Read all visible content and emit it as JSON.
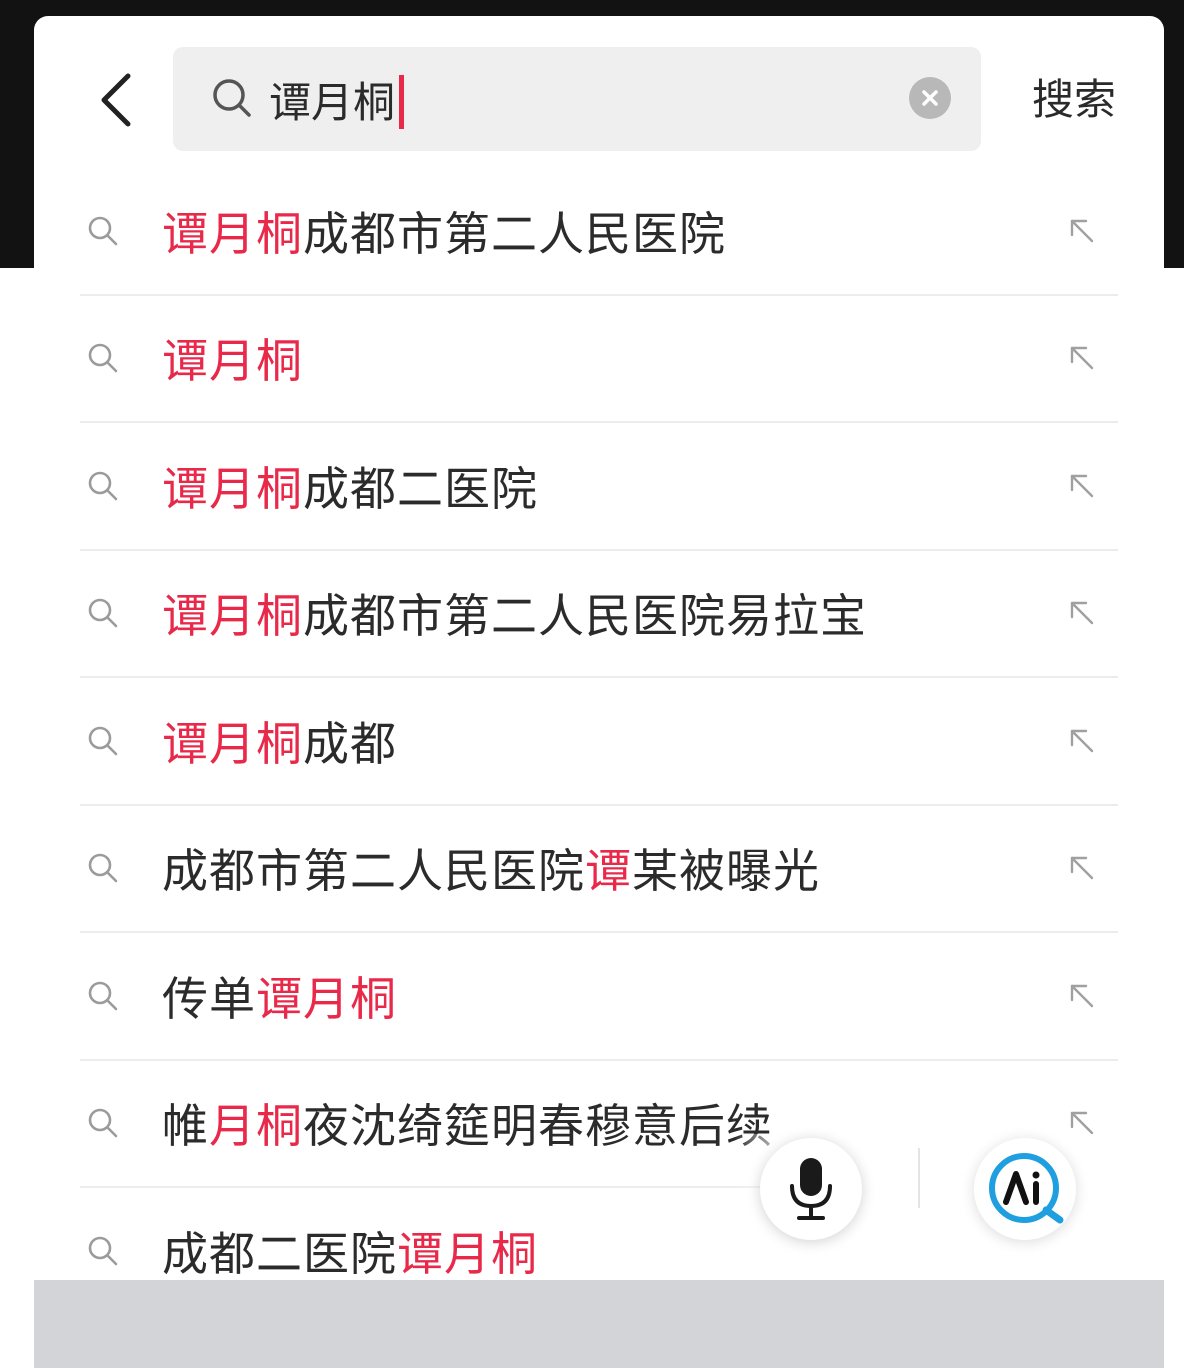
{
  "search": {
    "query": "谭月桐",
    "submit_label": "搜索"
  },
  "suggestions": [
    {
      "segments": [
        {
          "text": "谭月桐",
          "hl": true
        },
        {
          "text": "成都市第二人民医院",
          "hl": false
        }
      ]
    },
    {
      "segments": [
        {
          "text": "谭月桐",
          "hl": true
        }
      ]
    },
    {
      "segments": [
        {
          "text": "谭月桐",
          "hl": true
        },
        {
          "text": "成都二医院",
          "hl": false
        }
      ]
    },
    {
      "segments": [
        {
          "text": "谭月桐",
          "hl": true
        },
        {
          "text": "成都市第二人民医院易拉宝",
          "hl": false
        }
      ]
    },
    {
      "segments": [
        {
          "text": "谭月桐",
          "hl": true
        },
        {
          "text": "成都",
          "hl": false
        }
      ]
    },
    {
      "segments": [
        {
          "text": "成都市第二人民医院",
          "hl": false
        },
        {
          "text": "谭",
          "hl": true
        },
        {
          "text": "某被曝光",
          "hl": false
        }
      ]
    },
    {
      "segments": [
        {
          "text": "传单",
          "hl": false
        },
        {
          "text": "谭月桐",
          "hl": true
        }
      ]
    },
    {
      "segments": [
        {
          "text": "帷",
          "hl": false
        },
        {
          "text": "月桐",
          "hl": true
        },
        {
          "text": "夜沈绮筵明春穆意后续",
          "hl": false
        }
      ]
    },
    {
      "segments": [
        {
          "text": "成都二医院",
          "hl": false
        },
        {
          "text": "谭月桐",
          "hl": true
        }
      ]
    }
  ],
  "colors": {
    "highlight": "#e8294a",
    "text": "#2b2b2b",
    "ai_accent": "#1f9fe0"
  },
  "icons": {
    "back": "chevron-left-icon",
    "search": "search-icon",
    "clear": "clear-icon",
    "fill": "arrow-up-left-icon",
    "mic": "microphone-icon",
    "ai": "ai-logo-icon"
  }
}
